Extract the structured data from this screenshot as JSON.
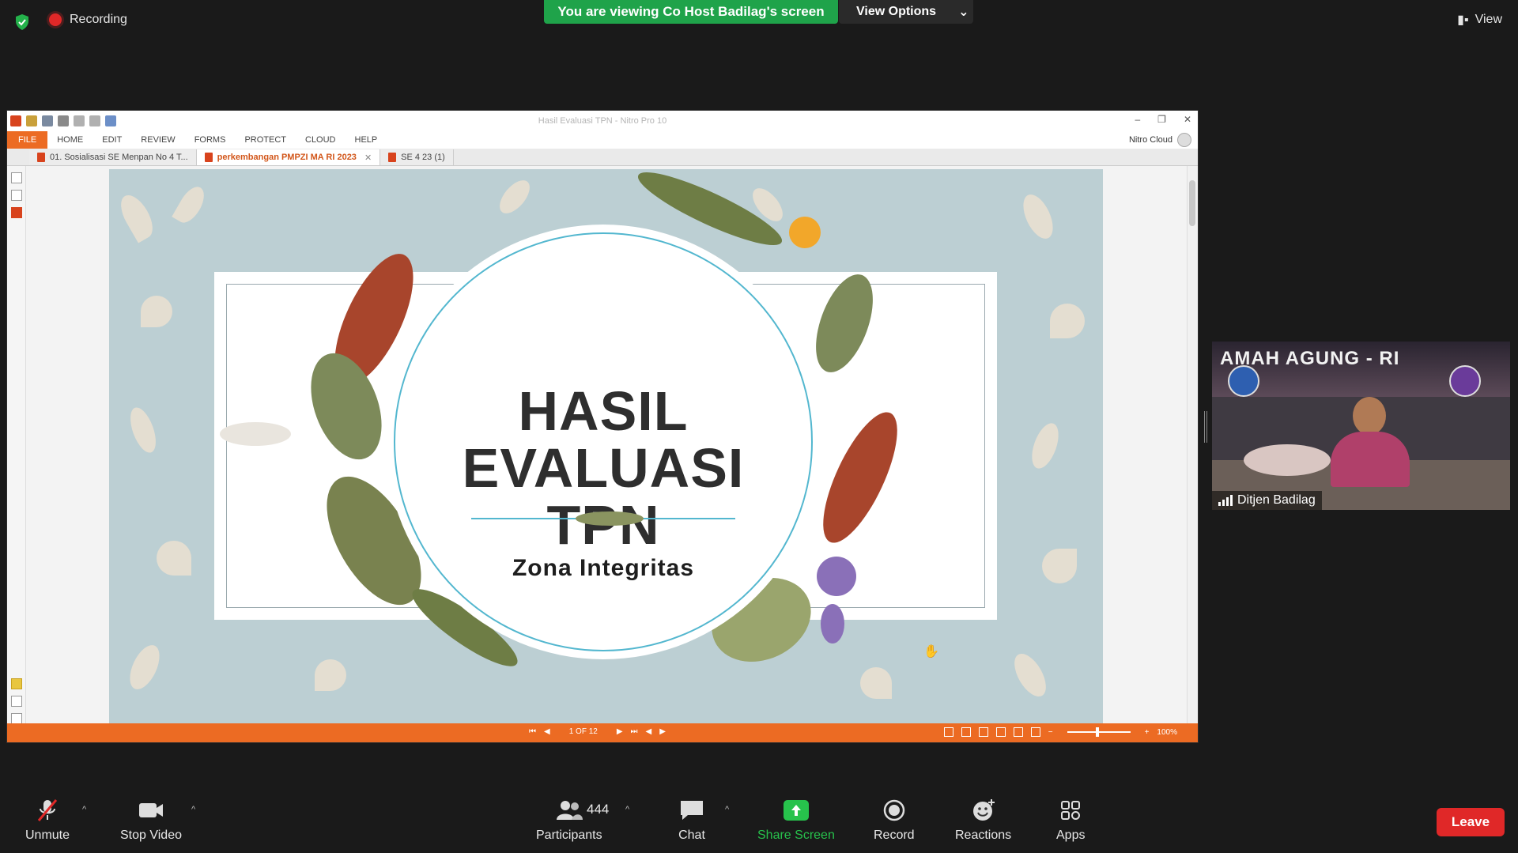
{
  "topbar": {
    "recording_label": "Recording",
    "viewing_banner": "You are viewing Co Host Badilag's screen",
    "view_options_label": "View Options",
    "view_label": "View"
  },
  "nitro": {
    "window_title": "Hasil Evaluasi TPN - Nitro Pro 10",
    "ribbon_tabs": [
      "FILE",
      "HOME",
      "EDIT",
      "REVIEW",
      "FORMS",
      "PROTECT",
      "CLOUD",
      "HELP"
    ],
    "nitro_cloud_label": "Nitro Cloud",
    "doc_tabs": [
      {
        "label": "01. Sosialisasi SE Menpan No 4 T...",
        "active": false
      },
      {
        "label": "perkembangan PMPZI MA RI 2023",
        "active": true
      },
      {
        "label": "SE 4 23 (1)",
        "active": false
      }
    ],
    "page_indicator": "1 OF 12",
    "zoom_level": "100%"
  },
  "slide": {
    "title_line1": "HASIL",
    "title_line2": "EVALUASI TPN",
    "subtitle": "Zona Integritas",
    "colors": {
      "background": "#bccfd3",
      "accent": "#53b7cf",
      "title": "#2e2e2e"
    }
  },
  "video": {
    "banner_text": "AMAH AGUNG - RI",
    "participant_name": "Ditjen Badilag"
  },
  "toolbar": {
    "unmute_label": "Unmute",
    "stop_video_label": "Stop Video",
    "participants_label": "Participants",
    "participants_count": "444",
    "chat_label": "Chat",
    "share_screen_label": "Share Screen",
    "record_label": "Record",
    "reactions_label": "Reactions",
    "apps_label": "Apps",
    "leave_label": "Leave",
    "accent_colors": {
      "share": "#27c24c",
      "leave": "#e02828"
    }
  }
}
